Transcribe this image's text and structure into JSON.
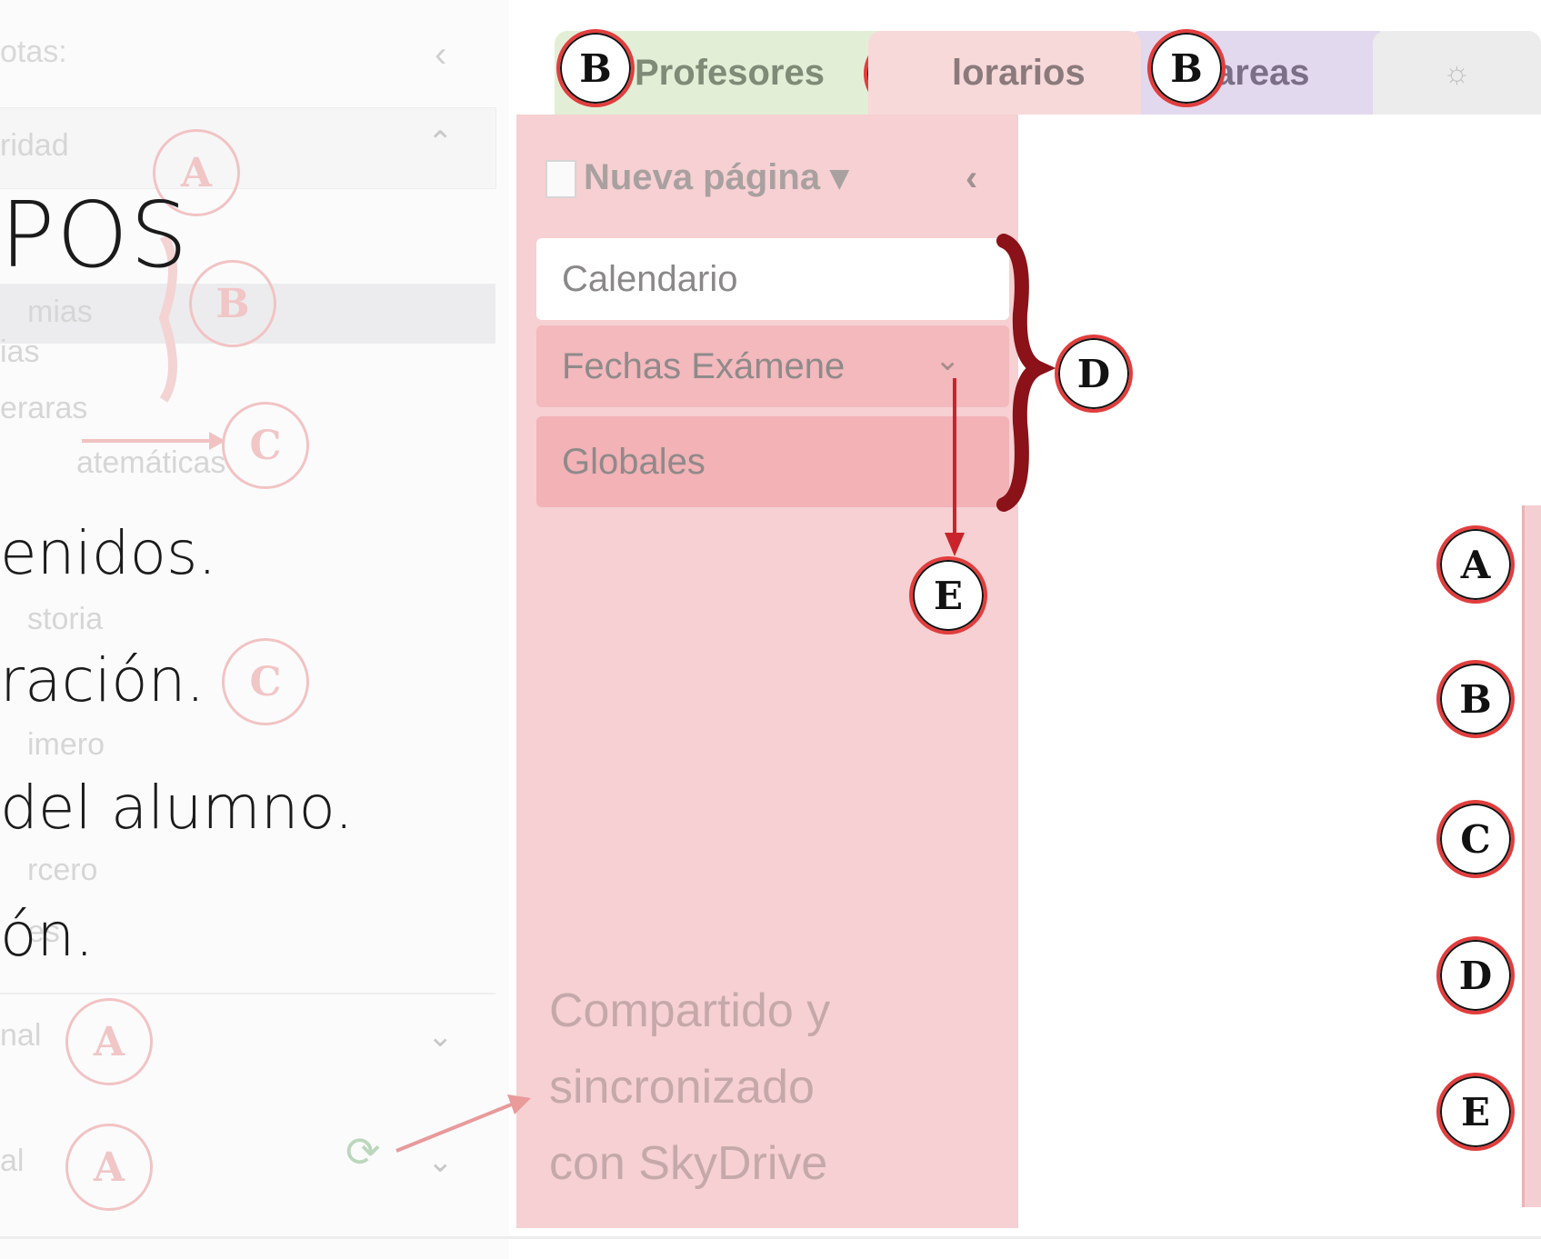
{
  "left_pane": {
    "header_fragment": "otas:",
    "row_fragment": "ridad",
    "section_fragment": "mias",
    "item_fragment": "ias",
    "item_fragment2": "eraras",
    "item_fragment3": "atemáticas",
    "item_fragment4": "storia",
    "item_fragment5": "imero",
    "item_fragment6": "rcero",
    "item_fragment7": "es",
    "item_fragment8": "nal",
    "item_fragment9": "al"
  },
  "slide_text": {
    "line_title": "POS",
    "line1": "enidos.",
    "line2": "ración.",
    "line3": "del alumno.",
    "line4": "ón."
  },
  "tabs": [
    {
      "label": "Profesores"
    },
    {
      "label": "lorarios"
    },
    {
      "label": "areas"
    }
  ],
  "tab_add_glyph": "☼",
  "toolbar": {
    "new_page_label": "Nueva página ▾",
    "collapse_glyph": "‹"
  },
  "pages": [
    {
      "label": "Calendario"
    },
    {
      "label": "Fechas Exámene"
    },
    {
      "label": "Globales"
    }
  ],
  "page_chevron": "⌄",
  "sync_status": [
    "Compartido y",
    "sincronizado",
    "con SkyDrive"
  ],
  "annotations": {
    "left_a": "A",
    "left_b": "B",
    "left_c": "C",
    "left_c2": "C",
    "left_a2": "A",
    "left_a3": "A",
    "tab_b": "B",
    "brace_d": "D",
    "arrow_e": "E",
    "legend": [
      "A",
      "B",
      "C",
      "D",
      "E"
    ]
  },
  "colors": {
    "annotation_red": "#e23d3d",
    "tab_profesores": "#e2efd6",
    "tab_horarios": "#f7d9da",
    "tab_tareas": "#e3d9ee",
    "pages_pane": "#f6d0d2"
  },
  "icons": {
    "collapse": "chevron-left-icon",
    "expand": "chevron-down-icon",
    "sync": "sync-check-icon",
    "new_page": "page-icon"
  }
}
